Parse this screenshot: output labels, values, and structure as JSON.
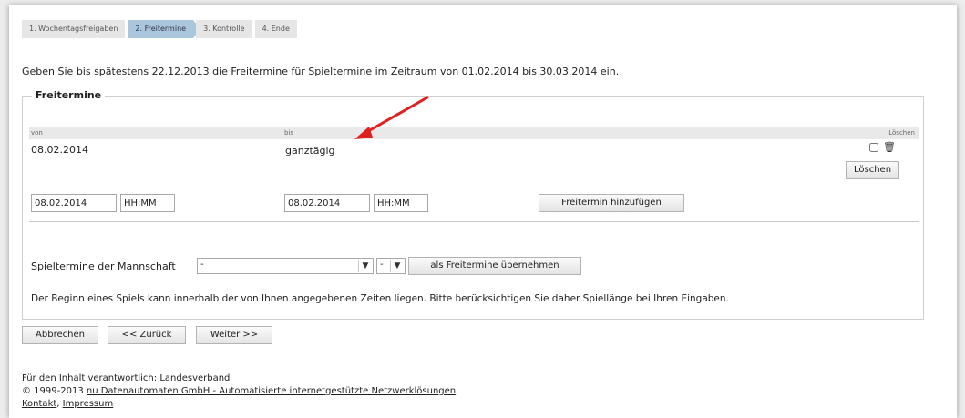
{
  "wizard": {
    "steps": [
      {
        "label": "1. Wochentagsfreigaben",
        "active": false
      },
      {
        "label": "2. Freitermine",
        "active": true
      },
      {
        "label": "3. Kontrolle",
        "active": false
      },
      {
        "label": "4. Ende",
        "active": false
      }
    ]
  },
  "intro": "Geben Sie bis spätestens 22.12.2013 die Freitermine für Spieltermine im Zeitraum von 01.02.2014 bis 30.03.2014 ein.",
  "freitermine": {
    "legend": "Freitermine",
    "columns": {
      "from": "von",
      "to": "bis",
      "delete": "Löschen"
    },
    "rows": [
      {
        "from": "08.02.2014",
        "to": "ganztägig"
      }
    ],
    "delete_button": "Löschen",
    "new_entry": {
      "from_date": "08.02.2014",
      "from_time": "HH:MM",
      "to_date": "08.02.2014",
      "to_time": "HH:MM",
      "add_button": "Freitermin hinzufügen"
    },
    "mannschaft": {
      "label": "Spieltermine der Mannschaft",
      "team_value": "-",
      "second_value": "-",
      "apply_button": "als Freitermine übernehmen"
    },
    "note": "Der Beginn eines Spiels kann innerhalb der von Ihnen angegebenen Zeiten liegen. Bitte berücksichtigen Sie daher Spiellänge bei Ihren Eingaben."
  },
  "nav": {
    "cancel": "Abbrechen",
    "back": "<< Zurück",
    "next": "Weiter >>"
  },
  "footer": {
    "responsible": "Für den Inhalt verantwortlich: Landesverband",
    "copyright_prefix": "© 1999-2013 ",
    "copyright_link": "nu Datenautomaten GmbH - Automatisierte internetgestützte Netzwerklösungen",
    "contact": "Kontakt",
    "imprint": "Impressum",
    "separator": ", "
  },
  "colors": {
    "active_step": "#a9c6dd",
    "annotation_arrow": "#e02020"
  },
  "icons": {
    "delete": "trash-icon",
    "dropdown": "chevron-down-icon"
  }
}
